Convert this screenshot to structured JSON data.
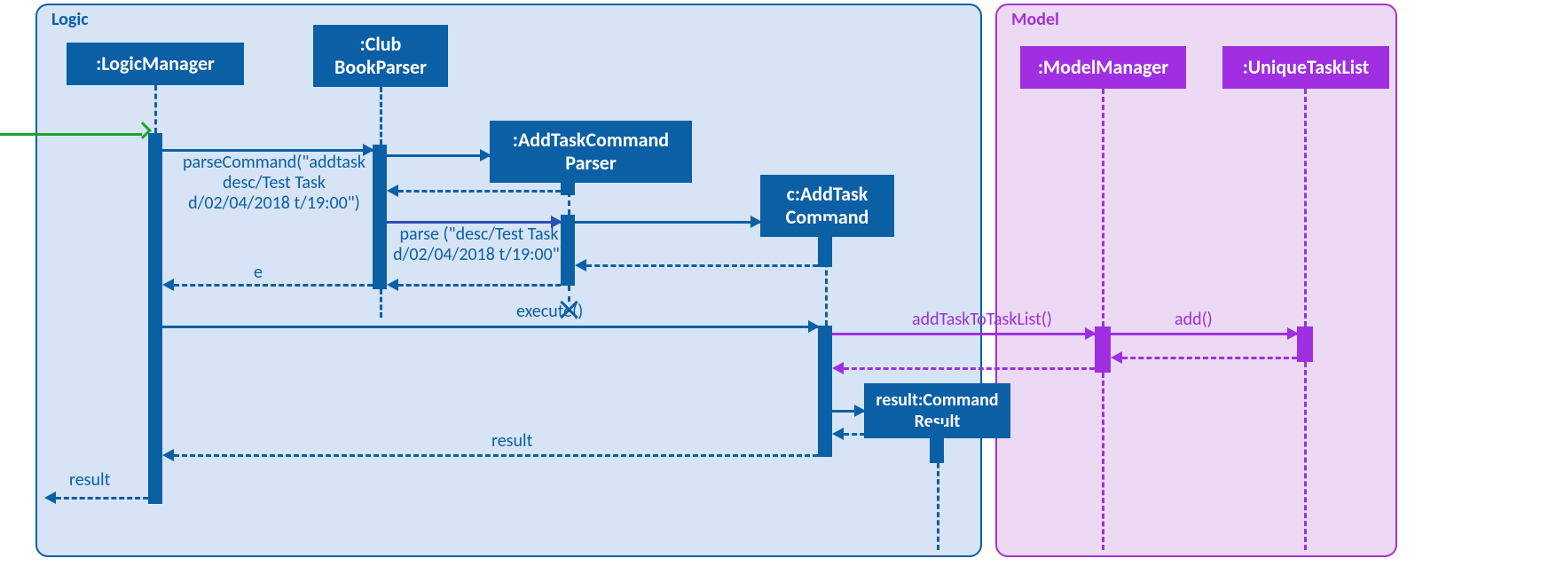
{
  "frames": {
    "logic": {
      "title": "Logic"
    },
    "model": {
      "title": "Model"
    }
  },
  "lifelines": {
    "logicManager": {
      "label": ":LogicManager"
    },
    "clubBookParser": {
      "label": ":Club\nBookParser"
    },
    "addTaskCmdParser": {
      "label": ":AddTaskCommand\nParser"
    },
    "addTaskCmd": {
      "label": "c:AddTask\nCommand"
    },
    "commandResult": {
      "label": "result:Command\nResult"
    },
    "modelManager": {
      "label": ":ModelManager"
    },
    "uniqueTaskList": {
      "label": ":UniqueTaskList"
    }
  },
  "messages": {
    "parseCommand": "parseCommand(\"addtask\ndesc/Test Task\nd/02/04/2018 t/19:00\")",
    "parse": "parse (\"desc/Test Task\nd/02/04/2018 t/19:00\")",
    "e": "e",
    "execute": "execute()",
    "addTaskToTaskList": "addTaskToTaskList()",
    "add": "add()",
    "result": "result",
    "resultOut": "result"
  },
  "colors": {
    "logicBg": "#d6e4f6",
    "logicBorder": "#0b5fa5",
    "logicHead": "#0b5fa5",
    "modelBg": "#ecd9f3",
    "modelBorder": "#a333d6",
    "modelHead": "#9f2fe0",
    "green": "#1fa32b"
  }
}
